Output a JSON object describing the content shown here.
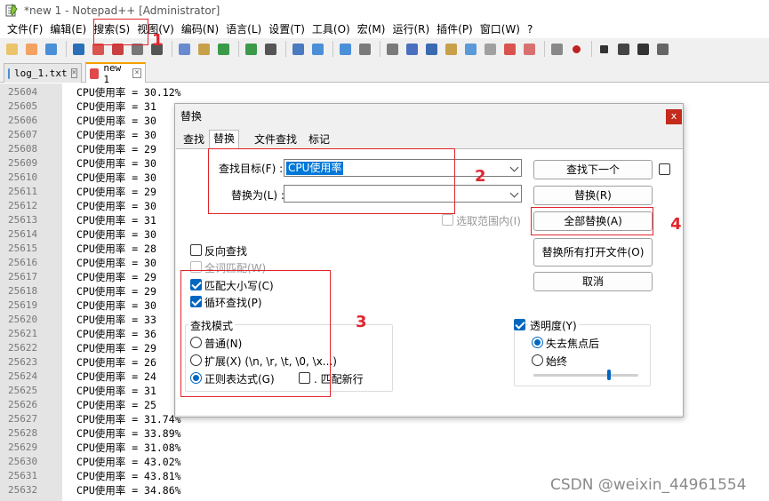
{
  "window": {
    "title": "*new 1 - Notepad++ [Administrator]"
  },
  "menu": [
    "文件(F)",
    "编辑(E)",
    "搜索(S)",
    "视图(V)",
    "编码(N)",
    "语言(L)",
    "设置(T)",
    "工具(O)",
    "宏(M)",
    "运行(R)",
    "插件(P)",
    "窗口(W)",
    "?"
  ],
  "toolbar": {
    "icons": [
      "new-icon",
      "open-icon",
      "save-icon",
      "save-all-icon",
      "close-icon",
      "close-all-icon",
      "print-icon",
      "cut-icon",
      "copy-icon",
      "paste-icon",
      "undo-icon",
      "redo-icon",
      "find-icon",
      "replace-icon",
      "zoom-in-icon",
      "zoom-out-icon",
      "sync-v-icon",
      "sync-h-icon",
      "wrap-icon",
      "all-chars-icon",
      "indent-guide-icon",
      "udl-icon",
      "doc-map-icon",
      "func-list-icon",
      "folder-icon",
      "monitor-icon",
      "record-icon",
      "stop-icon",
      "play-icon",
      "play-multi-icon",
      "save-macro-icon"
    ]
  },
  "tabs": [
    {
      "label": "log_1.txt",
      "active": false
    },
    {
      "label": "new 1",
      "active": true
    }
  ],
  "editor": {
    "lines": [
      {
        "n": "25604",
        "text": "CPU使用率 = 30.12%"
      },
      {
        "n": "25605",
        "text": "CPU使用率 = 31"
      },
      {
        "n": "25606",
        "text": "CPU使用率 = 30"
      },
      {
        "n": "25607",
        "text": "CPU使用率 = 30"
      },
      {
        "n": "25608",
        "text": "CPU使用率 = 29"
      },
      {
        "n": "25609",
        "text": "CPU使用率 = 30"
      },
      {
        "n": "25610",
        "text": "CPU使用率 = 30"
      },
      {
        "n": "25611",
        "text": "CPU使用率 = 29"
      },
      {
        "n": "25612",
        "text": "CPU使用率 = 30"
      },
      {
        "n": "25613",
        "text": "CPU使用率 = 31"
      },
      {
        "n": "25614",
        "text": "CPU使用率 = 30"
      },
      {
        "n": "25615",
        "text": "CPU使用率 = 28"
      },
      {
        "n": "25616",
        "text": "CPU使用率 = 30"
      },
      {
        "n": "25617",
        "text": "CPU使用率 = 29"
      },
      {
        "n": "25618",
        "text": "CPU使用率 = 29"
      },
      {
        "n": "25619",
        "text": "CPU使用率 = 30"
      },
      {
        "n": "25620",
        "text": "CPU使用率 = 33"
      },
      {
        "n": "25621",
        "text": "CPU使用率 = 36"
      },
      {
        "n": "25622",
        "text": "CPU使用率 = 29"
      },
      {
        "n": "25623",
        "text": "CPU使用率 = 26"
      },
      {
        "n": "25624",
        "text": "CPU使用率 = 24"
      },
      {
        "n": "25625",
        "text": "CPU使用率 = 31"
      },
      {
        "n": "25626",
        "text": "CPU使用率 = 25"
      },
      {
        "n": "25627",
        "text": "CPU使用率 = 31.74%"
      },
      {
        "n": "25628",
        "text": "CPU使用率 = 33.89%"
      },
      {
        "n": "25629",
        "text": "CPU使用率 = 31.08%"
      },
      {
        "n": "25630",
        "text": "CPU使用率 = 43.02%"
      },
      {
        "n": "25631",
        "text": "CPU使用率 = 43.81%"
      },
      {
        "n": "25632",
        "text": "CPU使用率 = 34.86%"
      }
    ]
  },
  "watermark": "CSDN @weixin_44961554",
  "dialog": {
    "title": "替换",
    "close": "x",
    "tabs": [
      "查找",
      "替换",
      "文件查找",
      "标记"
    ],
    "find_label": "查找目标(F) :",
    "find_value": "CPU使用率",
    "replace_label": "替换为(L) :",
    "replace_value": "",
    "in_selection_label": "选取范围内(I)",
    "buttons": {
      "find_next": "查找下一个",
      "replace": "替换(R)",
      "replace_all": "全部替换(A)",
      "replace_all_open": "替换所有打开文件(O)",
      "cancel": "取消"
    },
    "options": {
      "backward": {
        "label": "反向查找",
        "checked": false
      },
      "whole_word": {
        "label": "全词匹配(W)",
        "checked": false
      },
      "match_case": {
        "label": "匹配大小写(C)",
        "checked": true
      },
      "wrap": {
        "label": "循环查找(P)",
        "checked": true
      }
    },
    "search_mode": {
      "title": "查找模式",
      "normal": "普通(N)",
      "extended": "扩展(X) (\\n, \\r, \\t, \\0, \\x...)",
      "regex": "正则表达式(G)",
      "dot_newline": ". 匹配新行",
      "selected": "regex"
    },
    "transparency": {
      "label": "透明度(Y)",
      "checked": true,
      "on_lose_focus": "失去焦点后",
      "always": "始终",
      "selected": "on_lose_focus",
      "level": 0.72
    }
  },
  "annotations": [
    "1",
    "2",
    "3",
    "4"
  ],
  "colors": {
    "accent": "#0067c0",
    "annotation": "#e0262d",
    "close": "#c42b1c"
  }
}
